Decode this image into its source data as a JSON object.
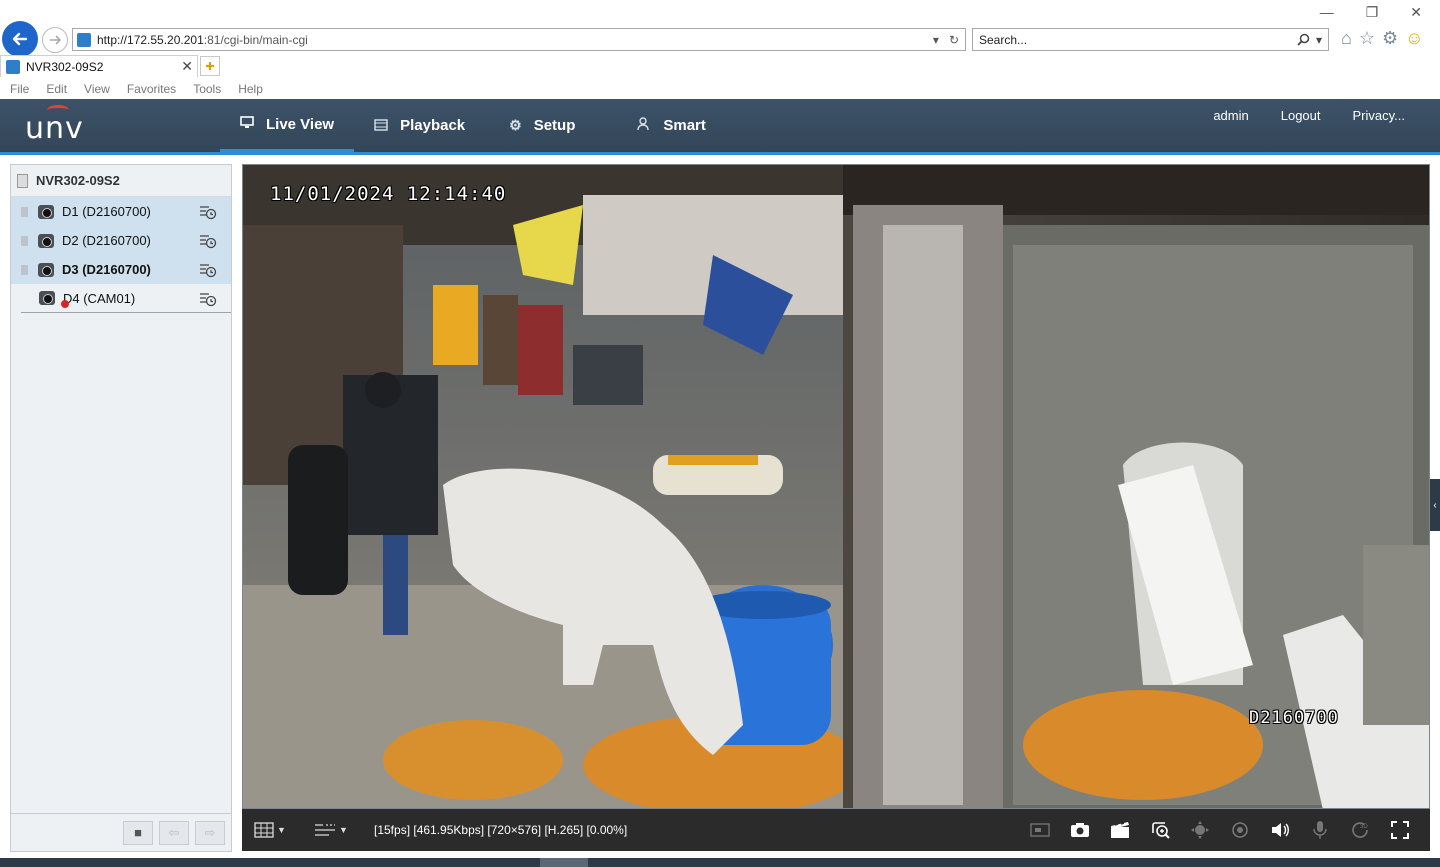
{
  "browser": {
    "url_host": "http://172.55.20.201",
    "url_rest": ":81/cgi-bin/main-cgi",
    "search_placeholder": "Search...",
    "tab_title": "NVR302-09S2",
    "menu": [
      "File",
      "Edit",
      "View",
      "Favorites",
      "Tools",
      "Help"
    ]
  },
  "app": {
    "logo": "unv",
    "nav": [
      {
        "label": "Live View",
        "icon": "monitor-icon",
        "active": true
      },
      {
        "label": "Playback",
        "icon": "film-icon"
      },
      {
        "label": "Setup",
        "icon": "gear-icon"
      },
      {
        "label": "Smart",
        "icon": "person-icon"
      }
    ],
    "user": {
      "name": "admin",
      "logout": "Logout",
      "privacy": "Privacy..."
    }
  },
  "sidebar": {
    "device": "NVR302-09S2",
    "channels": [
      {
        "label": "D1 (D2160700)",
        "selected": true,
        "status": "online"
      },
      {
        "label": "D2 (D2160700)",
        "selected": true,
        "status": "online"
      },
      {
        "label": "D3 (D2160700)",
        "selected": true,
        "status": "online",
        "bold": true
      },
      {
        "label": "D4 (CAM01)",
        "selected": false,
        "status": "offline"
      }
    ]
  },
  "video": {
    "osd_datetime": "11/01/2024 12:14:40",
    "osd_camera": "D2160700",
    "stream_info": "[15fps] [461.95Kbps] [720×576] [H.265] [0.00%]"
  },
  "colors": {
    "header_bg": "#364a5e",
    "accent": "#2a8fd8",
    "selected_row": "#cfe1ee",
    "control_bar": "#2b2b2b"
  }
}
